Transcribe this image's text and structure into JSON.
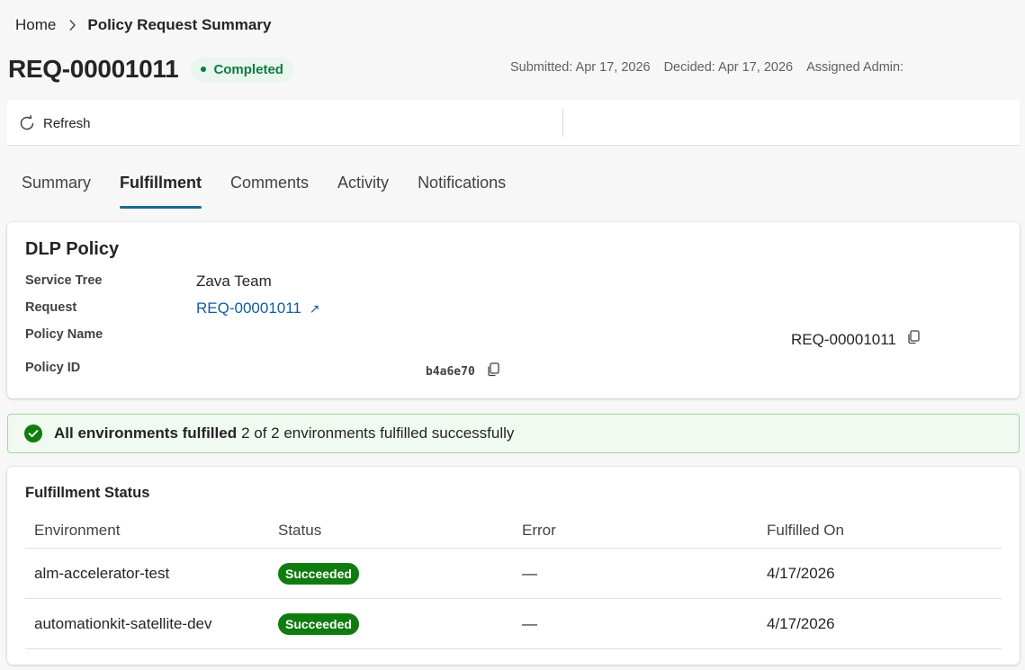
{
  "breadcrumb": {
    "home": "Home",
    "current": "Policy Request Summary"
  },
  "header": {
    "request_id": "REQ-00001011",
    "status": "Completed",
    "submitted": "Submitted: Apr 17, 2026",
    "decided": "Decided: Apr 17, 2026",
    "assigned_admin": "Assigned Admin:"
  },
  "toolbar": {
    "refresh_label": "Refresh"
  },
  "tabs": [
    {
      "label": "Summary"
    },
    {
      "label": "Fulfillment",
      "active": true
    },
    {
      "label": "Comments"
    },
    {
      "label": "Activity"
    },
    {
      "label": "Notifications"
    }
  ],
  "policy": {
    "title": "DLP Policy",
    "service_tree_label": "Service Tree",
    "service_tree_value": "Zava Team",
    "request_label": "Request",
    "request_value": "REQ-00001011",
    "request_link_icon": "↗",
    "policy_name_label": "Policy Name",
    "policy_name_value": "REQ-00001011",
    "policy_id_label": "Policy ID",
    "policy_id_value": "b4a6e70"
  },
  "banner": {
    "bold": "All environments fulfilled",
    "text": "2 of 2 environments fulfilled successfully"
  },
  "fulfillment": {
    "title": "Fulfillment Status",
    "columns": [
      "Environment",
      "Status",
      "Error",
      "Fulfilled On"
    ],
    "rows": [
      {
        "environment": "alm-accelerator-test",
        "status": "Succeeded",
        "error": "—",
        "fulfilled_on": "4/17/2026"
      },
      {
        "environment": "automationkit-satellite-dev",
        "status": "Succeeded",
        "error": "—",
        "fulfilled_on": "4/17/2026"
      }
    ]
  },
  "colors": {
    "accent": "#1a6b8f",
    "link": "#115ea3",
    "success": "#107c10",
    "completed_pill_bg": "#e8f6ee",
    "banner_bg": "#f1faf1"
  },
  "icons": [
    "chevron-right-icon",
    "refresh-icon",
    "external-link-icon",
    "copy-icon",
    "check-circle-icon"
  ]
}
